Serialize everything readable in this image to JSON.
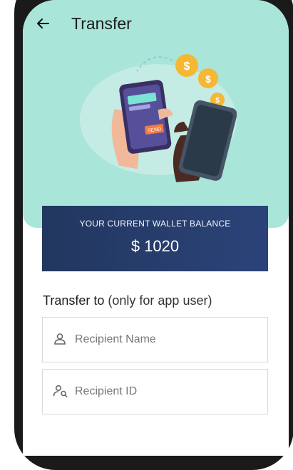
{
  "header": {
    "title": "Transfer"
  },
  "balance": {
    "label": "YOUR CURRENT WALLET BALANCE",
    "amount": "$ 1020"
  },
  "transfer": {
    "heading": "Transfer to",
    "note": "(only for app user)"
  },
  "fields": {
    "name_placeholder": "Recipient Name",
    "id_placeholder": "Recipient ID"
  },
  "illustration": {
    "send_label": "SEND"
  },
  "colors": {
    "hero_bg": "#a9e5d8",
    "balance_bg": "#26396a",
    "coin": "#f6b733"
  }
}
